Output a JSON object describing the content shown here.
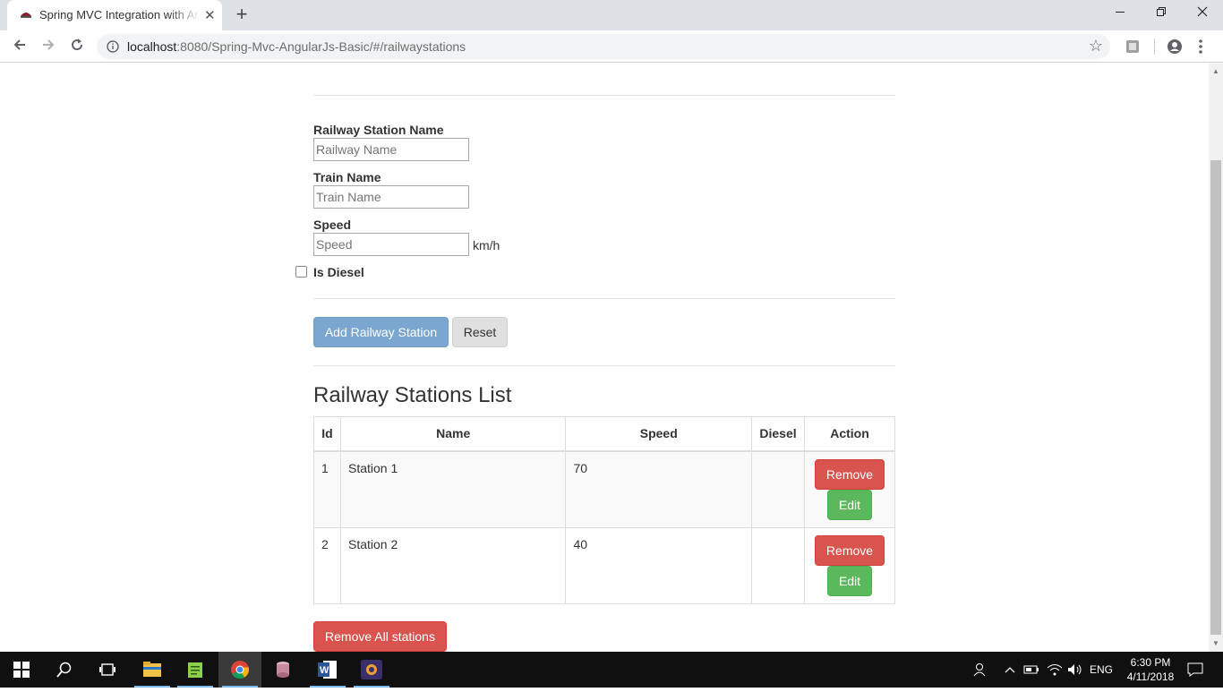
{
  "browser": {
    "tab_title": "Spring MVC Integration with AngularJs",
    "tab_close": "✕",
    "new_tab": "+",
    "url_host": "localhost",
    "url_rest": ":8080/Spring-Mvc-AngularJs-Basic/#/railwaystations",
    "win_minimize": "—",
    "win_restore": "❐",
    "win_close": "✕"
  },
  "form": {
    "station_label": "Railway Station Name",
    "station_placeholder": "Railway Name",
    "train_label": "Train Name",
    "train_placeholder": "Train Name",
    "speed_label": "Speed",
    "speed_placeholder": "Speed",
    "speed_unit": "km/h",
    "diesel_label": "Is Diesel",
    "diesel_checked": false,
    "add_button": "Add Railway Station",
    "reset_button": "Reset"
  },
  "list": {
    "heading": "Railway Stations List",
    "columns": [
      "Id",
      "Name",
      "Speed",
      "Diesel",
      "Action"
    ],
    "rows": [
      {
        "id": "1",
        "name": "Station 1",
        "speed": "70",
        "diesel": "",
        "remove": "Remove",
        "edit": "Edit"
      },
      {
        "id": "2",
        "name": "Station 2",
        "speed": "40",
        "diesel": "",
        "remove": "Remove",
        "edit": "Edit"
      }
    ],
    "remove_all": "Remove All stations"
  },
  "taskbar": {
    "language": "ENG",
    "time": "6:30 PM",
    "date": "4/11/2018"
  },
  "colors": {
    "danger": "#d9534f",
    "success": "#5cb85c",
    "primary_disabled": "#7aa6cf"
  }
}
